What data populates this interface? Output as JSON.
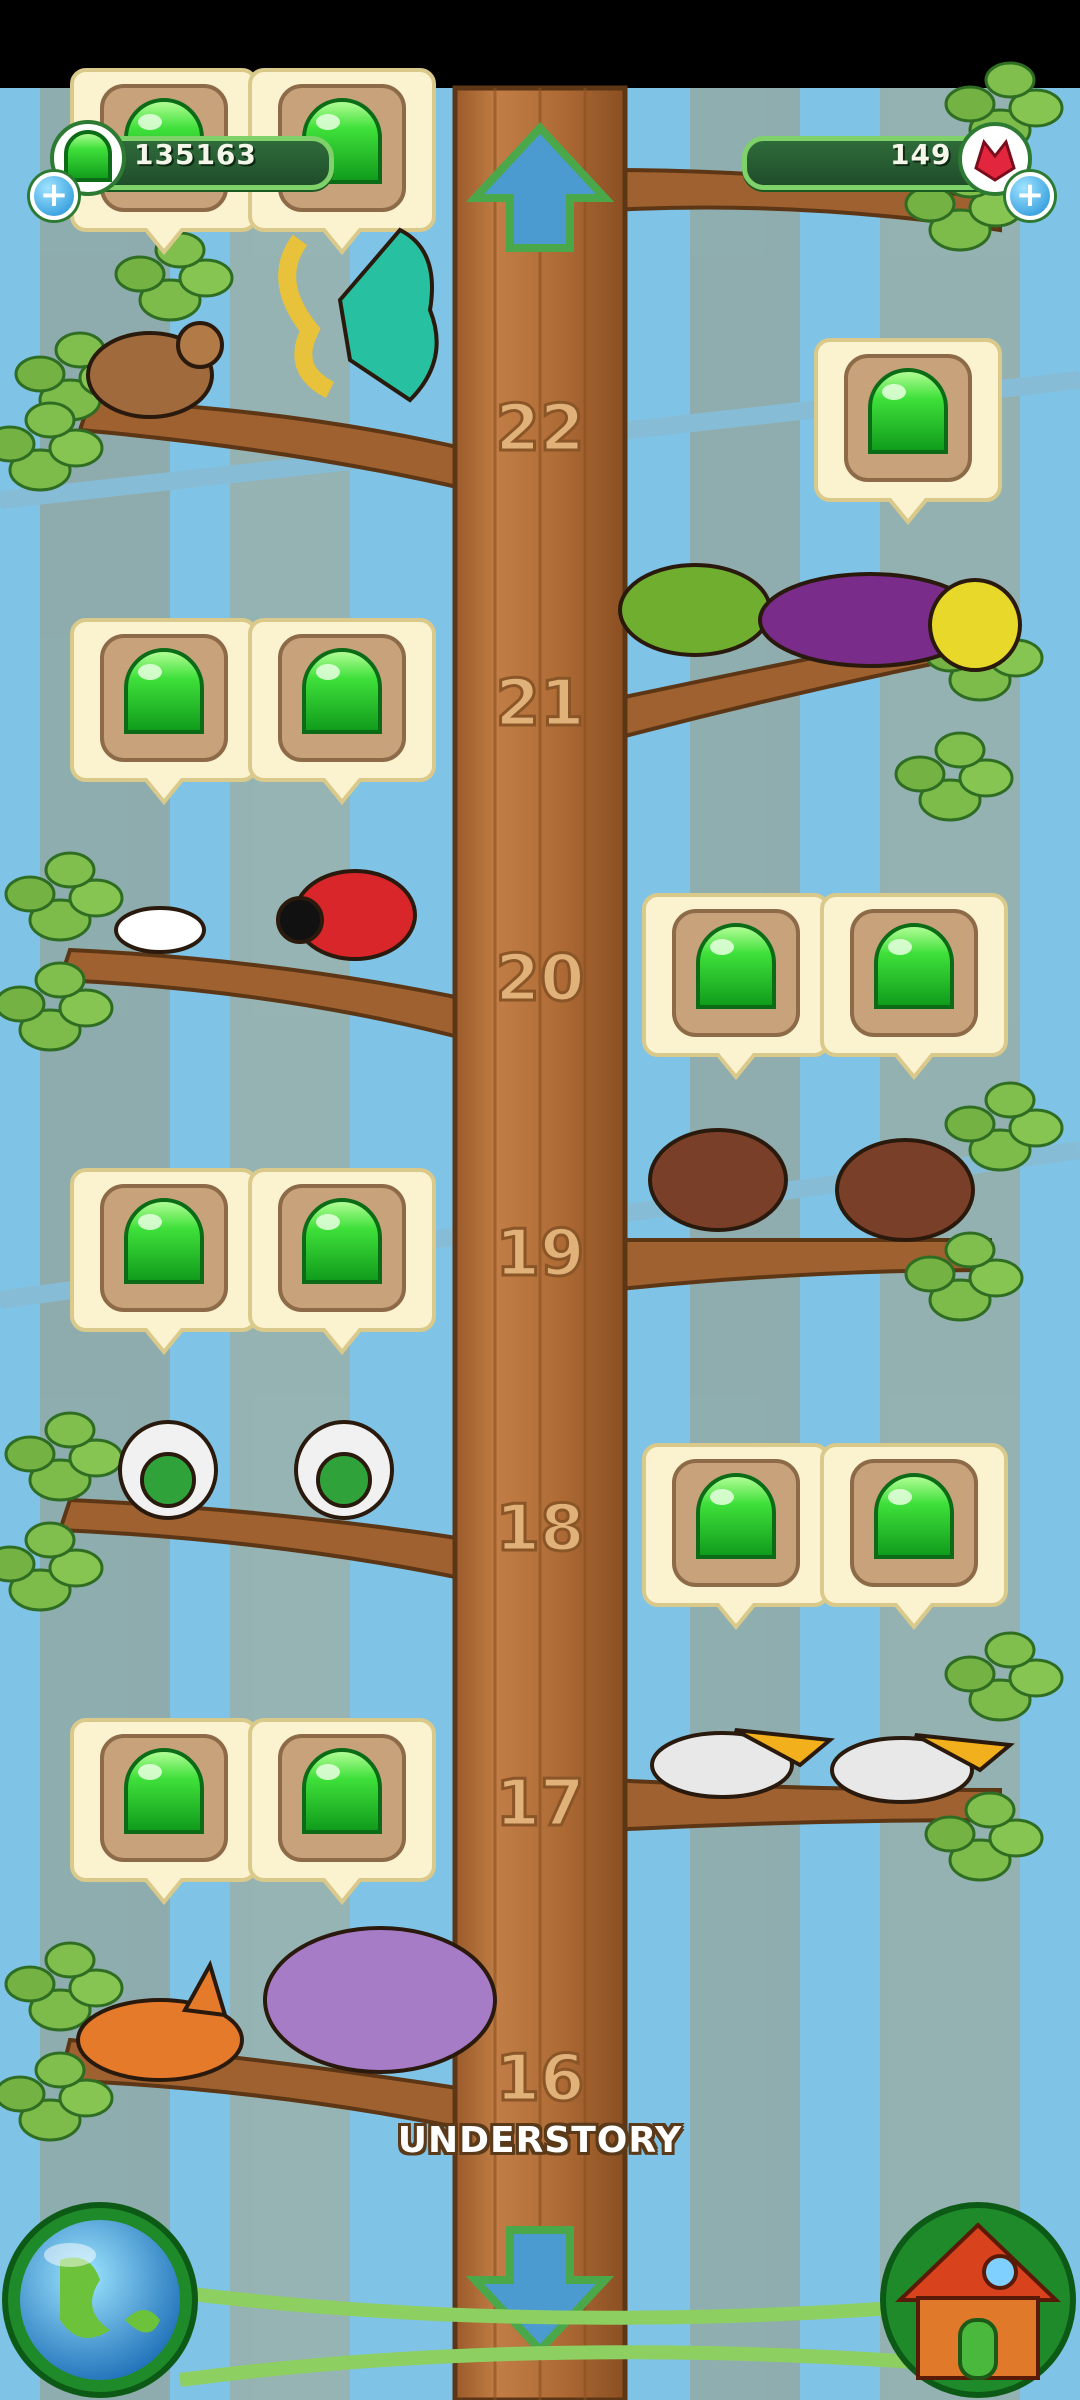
{
  "hud": {
    "left_counter": "135163",
    "right_counter": "149",
    "plus_symbol": "+"
  },
  "floors": [
    "22",
    "21",
    "20",
    "19",
    "18",
    "17",
    "16"
  ],
  "region_label": "UNDERSTORY",
  "colors": {
    "sky": "#7fc3e6",
    "trunk": "#b8753f",
    "branch": "#9b5e2c",
    "leaf": "#78b84a",
    "gem": "#2fd13a",
    "slot_bg": "#fbf3cf",
    "hud_bg": "#1f4d2a"
  },
  "icons": {
    "scroll_up": "up-arrow-icon",
    "scroll_down": "down-arrow-icon",
    "world": "globe-icon",
    "home": "house-icon",
    "currency_left": "green-gem-icon",
    "currency_right": "red-crystal-icon"
  }
}
